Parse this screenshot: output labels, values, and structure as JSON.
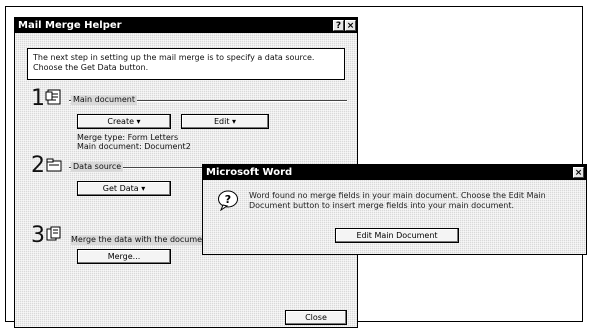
{
  "mail_merge_helper": {
    "title": "Mail Merge Helper",
    "help_btn": "?",
    "close_btn": "×",
    "instructions": "The next step in setting up the mail merge is to specify a data source. Choose the Get Data button.",
    "step1": {
      "number": "1",
      "label": "Main document",
      "create_label": "Create ▾",
      "edit_label": "Edit ▾",
      "merge_type": "Merge type: Form Letters",
      "main_document": "Main document: Document2"
    },
    "step2": {
      "number": "2",
      "label": "Data source",
      "get_data_label": "Get Data ▾"
    },
    "step3": {
      "number": "3",
      "label": "Merge the data with the docume",
      "merge_label": "Merge..."
    },
    "close_label": "Close"
  },
  "word_dialog": {
    "title": "Microsoft Word",
    "close_btn": "×",
    "message": "Word found no merge fields in your main document. Choose the Edit Main Document button to insert merge fields into your main document.",
    "edit_main_label": "Edit Main Document"
  }
}
